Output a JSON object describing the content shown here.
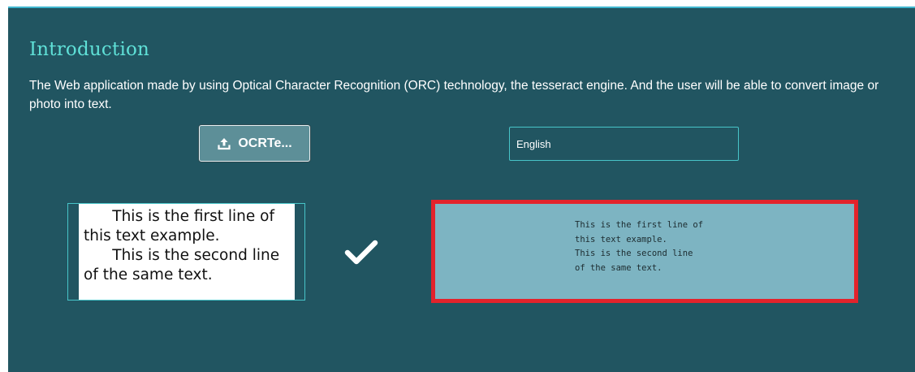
{
  "intro": {
    "title": "Introduction",
    "description": "The Web application made by using Optical Character Recognition (ORC) technology, the tesseract engine. And the user will be able to convert image or photo into text."
  },
  "upload": {
    "label": "OCRTe...",
    "icon": "upload-icon"
  },
  "language": {
    "value": "English"
  },
  "source_image": {
    "text": "      This is the first line of\nthis text example.\n      This is the second line\nof the same text."
  },
  "status": {
    "icon": "checkmark-icon"
  },
  "result": {
    "text": "This is the first line of\nthis text example.\nThis is the second line\nof the same text."
  },
  "colors": {
    "panel_background": "#215561",
    "title": "#5fe0d7",
    "accent_border": "#47c4c8",
    "result_background": "#7db4c2",
    "result_highlight": "#e3232b"
  }
}
